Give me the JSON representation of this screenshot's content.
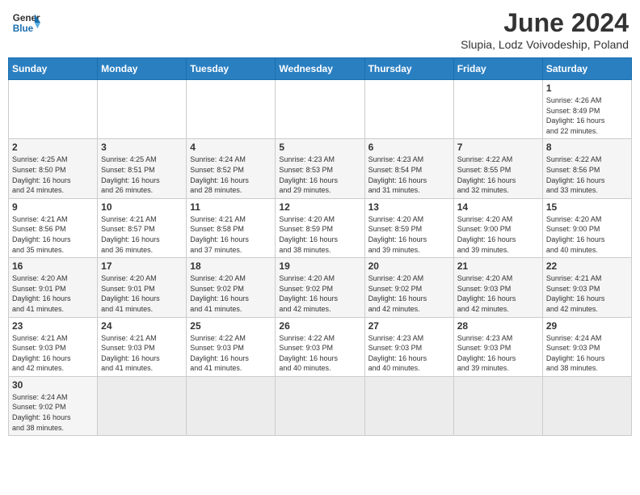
{
  "logo": {
    "line1": "General",
    "line2": "Blue"
  },
  "title": "June 2024",
  "subtitle": "Slupia, Lodz Voivodeship, Poland",
  "days_of_week": [
    "Sunday",
    "Monday",
    "Tuesday",
    "Wednesday",
    "Thursday",
    "Friday",
    "Saturday"
  ],
  "weeks": [
    [
      {
        "day": "",
        "info": ""
      },
      {
        "day": "",
        "info": ""
      },
      {
        "day": "",
        "info": ""
      },
      {
        "day": "",
        "info": ""
      },
      {
        "day": "",
        "info": ""
      },
      {
        "day": "",
        "info": ""
      },
      {
        "day": "1",
        "info": "Sunrise: 4:26 AM\nSunset: 8:49 PM\nDaylight: 16 hours\nand 22 minutes."
      }
    ],
    [
      {
        "day": "2",
        "info": "Sunrise: 4:25 AM\nSunset: 8:50 PM\nDaylight: 16 hours\nand 24 minutes."
      },
      {
        "day": "3",
        "info": "Sunrise: 4:25 AM\nSunset: 8:51 PM\nDaylight: 16 hours\nand 26 minutes."
      },
      {
        "day": "4",
        "info": "Sunrise: 4:24 AM\nSunset: 8:52 PM\nDaylight: 16 hours\nand 28 minutes."
      },
      {
        "day": "5",
        "info": "Sunrise: 4:23 AM\nSunset: 8:53 PM\nDaylight: 16 hours\nand 29 minutes."
      },
      {
        "day": "6",
        "info": "Sunrise: 4:23 AM\nSunset: 8:54 PM\nDaylight: 16 hours\nand 31 minutes."
      },
      {
        "day": "7",
        "info": "Sunrise: 4:22 AM\nSunset: 8:55 PM\nDaylight: 16 hours\nand 32 minutes."
      },
      {
        "day": "8",
        "info": "Sunrise: 4:22 AM\nSunset: 8:56 PM\nDaylight: 16 hours\nand 33 minutes."
      }
    ],
    [
      {
        "day": "9",
        "info": "Sunrise: 4:21 AM\nSunset: 8:56 PM\nDaylight: 16 hours\nand 35 minutes."
      },
      {
        "day": "10",
        "info": "Sunrise: 4:21 AM\nSunset: 8:57 PM\nDaylight: 16 hours\nand 36 minutes."
      },
      {
        "day": "11",
        "info": "Sunrise: 4:21 AM\nSunset: 8:58 PM\nDaylight: 16 hours\nand 37 minutes."
      },
      {
        "day": "12",
        "info": "Sunrise: 4:20 AM\nSunset: 8:59 PM\nDaylight: 16 hours\nand 38 minutes."
      },
      {
        "day": "13",
        "info": "Sunrise: 4:20 AM\nSunset: 8:59 PM\nDaylight: 16 hours\nand 39 minutes."
      },
      {
        "day": "14",
        "info": "Sunrise: 4:20 AM\nSunset: 9:00 PM\nDaylight: 16 hours\nand 39 minutes."
      },
      {
        "day": "15",
        "info": "Sunrise: 4:20 AM\nSunset: 9:00 PM\nDaylight: 16 hours\nand 40 minutes."
      }
    ],
    [
      {
        "day": "16",
        "info": "Sunrise: 4:20 AM\nSunset: 9:01 PM\nDaylight: 16 hours\nand 41 minutes."
      },
      {
        "day": "17",
        "info": "Sunrise: 4:20 AM\nSunset: 9:01 PM\nDaylight: 16 hours\nand 41 minutes."
      },
      {
        "day": "18",
        "info": "Sunrise: 4:20 AM\nSunset: 9:02 PM\nDaylight: 16 hours\nand 41 minutes."
      },
      {
        "day": "19",
        "info": "Sunrise: 4:20 AM\nSunset: 9:02 PM\nDaylight: 16 hours\nand 42 minutes."
      },
      {
        "day": "20",
        "info": "Sunrise: 4:20 AM\nSunset: 9:02 PM\nDaylight: 16 hours\nand 42 minutes."
      },
      {
        "day": "21",
        "info": "Sunrise: 4:20 AM\nSunset: 9:03 PM\nDaylight: 16 hours\nand 42 minutes."
      },
      {
        "day": "22",
        "info": "Sunrise: 4:21 AM\nSunset: 9:03 PM\nDaylight: 16 hours\nand 42 minutes."
      }
    ],
    [
      {
        "day": "23",
        "info": "Sunrise: 4:21 AM\nSunset: 9:03 PM\nDaylight: 16 hours\nand 42 minutes."
      },
      {
        "day": "24",
        "info": "Sunrise: 4:21 AM\nSunset: 9:03 PM\nDaylight: 16 hours\nand 41 minutes."
      },
      {
        "day": "25",
        "info": "Sunrise: 4:22 AM\nSunset: 9:03 PM\nDaylight: 16 hours\nand 41 minutes."
      },
      {
        "day": "26",
        "info": "Sunrise: 4:22 AM\nSunset: 9:03 PM\nDaylight: 16 hours\nand 40 minutes."
      },
      {
        "day": "27",
        "info": "Sunrise: 4:23 AM\nSunset: 9:03 PM\nDaylight: 16 hours\nand 40 minutes."
      },
      {
        "day": "28",
        "info": "Sunrise: 4:23 AM\nSunset: 9:03 PM\nDaylight: 16 hours\nand 39 minutes."
      },
      {
        "day": "29",
        "info": "Sunrise: 4:24 AM\nSunset: 9:03 PM\nDaylight: 16 hours\nand 38 minutes."
      }
    ],
    [
      {
        "day": "30",
        "info": "Sunrise: 4:24 AM\nSunset: 9:02 PM\nDaylight: 16 hours\nand 38 minutes."
      },
      {
        "day": "",
        "info": ""
      },
      {
        "day": "",
        "info": ""
      },
      {
        "day": "",
        "info": ""
      },
      {
        "day": "",
        "info": ""
      },
      {
        "day": "",
        "info": ""
      },
      {
        "day": "",
        "info": ""
      }
    ]
  ]
}
